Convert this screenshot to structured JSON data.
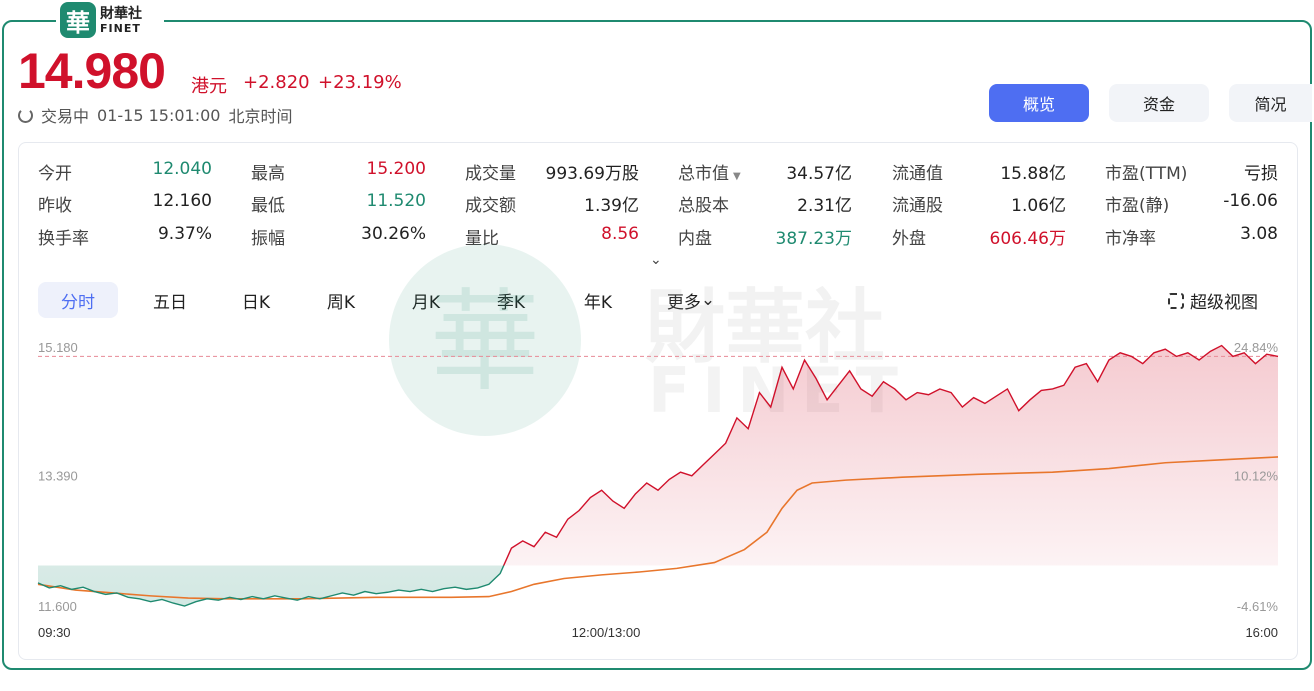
{
  "brand": {
    "seal": "華",
    "name_cn": "財華社",
    "name_en": "FINET",
    "watermark_cn": "財華社",
    "watermark_en": "FINET"
  },
  "quote": {
    "price": "14.980",
    "currency": "港元",
    "change": "+2.820",
    "change_pct": "+23.19%",
    "status": "交易中",
    "datetime": "01-15 15:01:00",
    "timezone": "北京时间"
  },
  "view_buttons": [
    {
      "label": "概览",
      "active": true
    },
    {
      "label": "资金",
      "active": false
    },
    {
      "label": "简况",
      "active": false
    }
  ],
  "stats": [
    [
      {
        "label": "今开",
        "value": "12.040",
        "color": "green"
      },
      {
        "label": "昨收",
        "value": "12.160",
        "color": "dark"
      },
      {
        "label": "换手率",
        "value": "9.37%",
        "color": "dark"
      }
    ],
    [
      {
        "label": "最高",
        "value": "15.200",
        "color": "red"
      },
      {
        "label": "最低",
        "value": "11.520",
        "color": "green"
      },
      {
        "label": "振幅",
        "value": "30.26%",
        "color": "dark"
      }
    ],
    [
      {
        "label": "成交量",
        "value": "993.69万股",
        "color": "dark"
      },
      {
        "label": "成交额",
        "value": "1.39亿",
        "color": "dark"
      },
      {
        "label": "量比",
        "value": "8.56",
        "color": "red"
      }
    ],
    [
      {
        "label": "总市值",
        "value": "34.57亿",
        "color": "dark"
      },
      {
        "label": "总股本",
        "value": "2.31亿",
        "color": "dark"
      },
      {
        "label": "内盘",
        "value": "387.23万",
        "color": "green"
      }
    ],
    [
      {
        "label": "流通值",
        "value": "15.88亿",
        "color": "dark"
      },
      {
        "label": "流通股",
        "value": "1.06亿",
        "color": "dark"
      },
      {
        "label": "外盘",
        "value": "606.46万",
        "color": "red"
      }
    ],
    [
      {
        "label": "市盈(TTM)",
        "value": "亏损",
        "color": "dark"
      },
      {
        "label": "市盈(静)",
        "value": "-16.06",
        "color": "dark"
      },
      {
        "label": "市净率",
        "value": "3.08",
        "color": "dark"
      }
    ]
  ],
  "period_tabs": [
    {
      "label": "分时",
      "active": true
    },
    {
      "label": "五日"
    },
    {
      "label": "日K"
    },
    {
      "label": "周K"
    },
    {
      "label": "月K"
    },
    {
      "label": "季K"
    },
    {
      "label": "年K"
    },
    {
      "label": "更多"
    }
  ],
  "super_view_label": "超级视图",
  "colors": {
    "up": "#d0112b",
    "down": "#1f8a70",
    "accent": "#4e6ef2",
    "avg_line": "#e8762c"
  },
  "chart_data": {
    "type": "line",
    "title": "",
    "y_ticks": [
      "15.180",
      "13.390",
      "11.600"
    ],
    "y_pct_ticks": [
      "24.84%",
      "10.12%",
      "-4.61%"
    ],
    "x_ticks": [
      "09:30",
      "12:00/13:00",
      "16:00"
    ],
    "ylim": [
      11.6,
      15.18
    ],
    "prev_close": 12.16,
    "reference_line": 15.05,
    "x_range": [
      0,
      330
    ],
    "price_series": [
      [
        0,
        11.92
      ],
      [
        3,
        11.85
      ],
      [
        6,
        11.88
      ],
      [
        9,
        11.83
      ],
      [
        12,
        11.86
      ],
      [
        15,
        11.8
      ],
      [
        18,
        11.76
      ],
      [
        21,
        11.78
      ],
      [
        24,
        11.72
      ],
      [
        27,
        11.7
      ],
      [
        30,
        11.66
      ],
      [
        33,
        11.69
      ],
      [
        36,
        11.64
      ],
      [
        39,
        11.6
      ],
      [
        42,
        11.66
      ],
      [
        45,
        11.7
      ],
      [
        48,
        11.68
      ],
      [
        51,
        11.72
      ],
      [
        54,
        11.69
      ],
      [
        57,
        11.73
      ],
      [
        60,
        11.7
      ],
      [
        63,
        11.74
      ],
      [
        66,
        11.71
      ],
      [
        69,
        11.68
      ],
      [
        72,
        11.73
      ],
      [
        75,
        11.7
      ],
      [
        78,
        11.74
      ],
      [
        81,
        11.78
      ],
      [
        84,
        11.75
      ],
      [
        87,
        11.8
      ],
      [
        90,
        11.77
      ],
      [
        93,
        11.79
      ],
      [
        96,
        11.82
      ],
      [
        99,
        11.8
      ],
      [
        102,
        11.83
      ],
      [
        105,
        11.8
      ],
      [
        108,
        11.84
      ],
      [
        111,
        11.86
      ],
      [
        114,
        11.83
      ],
      [
        117,
        11.85
      ],
      [
        120,
        11.9
      ],
      [
        123,
        12.05
      ],
      [
        126,
        12.4
      ],
      [
        129,
        12.5
      ],
      [
        132,
        12.42
      ],
      [
        135,
        12.62
      ],
      [
        138,
        12.55
      ],
      [
        141,
        12.8
      ],
      [
        144,
        12.92
      ],
      [
        147,
        13.1
      ],
      [
        150,
        13.2
      ],
      [
        153,
        13.05
      ],
      [
        156,
        12.95
      ],
      [
        159,
        13.15
      ],
      [
        162,
        13.3
      ],
      [
        165,
        13.2
      ],
      [
        168,
        13.35
      ],
      [
        171,
        13.45
      ],
      [
        174,
        13.4
      ],
      [
        177,
        13.55
      ],
      [
        180,
        13.7
      ],
      [
        183,
        13.85
      ],
      [
        186,
        14.2
      ],
      [
        189,
        14.05
      ],
      [
        192,
        14.55
      ],
      [
        195,
        14.35
      ],
      [
        198,
        14.9
      ],
      [
        201,
        14.6
      ],
      [
        204,
        15.0
      ],
      [
        207,
        14.75
      ],
      [
        210,
        14.45
      ],
      [
        213,
        14.65
      ],
      [
        216,
        14.85
      ],
      [
        219,
        14.6
      ],
      [
        222,
        14.5
      ],
      [
        225,
        14.7
      ],
      [
        228,
        14.6
      ],
      [
        231,
        14.45
      ],
      [
        234,
        14.55
      ],
      [
        237,
        14.52
      ],
      [
        240,
        14.6
      ],
      [
        243,
        14.55
      ],
      [
        246,
        14.35
      ],
      [
        249,
        14.48
      ],
      [
        252,
        14.4
      ],
      [
        255,
        14.5
      ],
      [
        258,
        14.6
      ],
      [
        261,
        14.3
      ],
      [
        264,
        14.45
      ],
      [
        267,
        14.58
      ],
      [
        270,
        14.6
      ],
      [
        273,
        14.65
      ],
      [
        276,
        14.9
      ],
      [
        279,
        14.95
      ],
      [
        282,
        14.7
      ],
      [
        285,
        15.0
      ],
      [
        288,
        15.1
      ],
      [
        291,
        15.05
      ],
      [
        294,
        14.95
      ],
      [
        297,
        15.1
      ],
      [
        300,
        15.15
      ],
      [
        303,
        15.05
      ],
      [
        306,
        15.1
      ],
      [
        309,
        15.0
      ],
      [
        312,
        15.12
      ],
      [
        315,
        15.2
      ],
      [
        318,
        15.05
      ],
      [
        321,
        15.1
      ],
      [
        324,
        14.95
      ],
      [
        327,
        15.08
      ],
      [
        330,
        15.05
      ]
    ],
    "avg_series": [
      [
        0,
        11.9
      ],
      [
        10,
        11.82
      ],
      [
        20,
        11.78
      ],
      [
        30,
        11.74
      ],
      [
        40,
        11.71
      ],
      [
        50,
        11.7
      ],
      [
        60,
        11.7
      ],
      [
        70,
        11.7
      ],
      [
        80,
        11.71
      ],
      [
        90,
        11.72
      ],
      [
        100,
        11.72
      ],
      [
        110,
        11.72
      ],
      [
        120,
        11.73
      ],
      [
        126,
        11.8
      ],
      [
        132,
        11.9
      ],
      [
        140,
        11.98
      ],
      [
        150,
        12.03
      ],
      [
        160,
        12.07
      ],
      [
        170,
        12.12
      ],
      [
        180,
        12.2
      ],
      [
        188,
        12.38
      ],
      [
        194,
        12.62
      ],
      [
        198,
        12.95
      ],
      [
        202,
        13.2
      ],
      [
        206,
        13.3
      ],
      [
        215,
        13.34
      ],
      [
        230,
        13.38
      ],
      [
        250,
        13.42
      ],
      [
        270,
        13.45
      ],
      [
        285,
        13.5
      ],
      [
        300,
        13.58
      ],
      [
        315,
        13.62
      ],
      [
        330,
        13.66
      ]
    ]
  }
}
